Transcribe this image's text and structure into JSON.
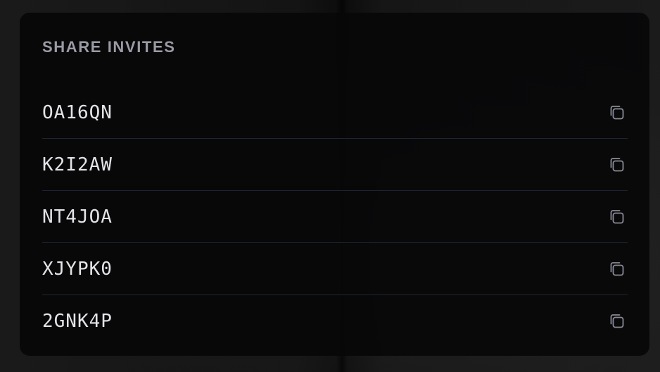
{
  "panel": {
    "title": "SHARE INVITES"
  },
  "invites": [
    {
      "code": "OA16QN",
      "action_icon": "copy-icon"
    },
    {
      "code": "K2I2AW",
      "action_icon": "copy-icon"
    },
    {
      "code": "NT4JOA",
      "action_icon": "copy-icon"
    },
    {
      "code": "XJYPK0",
      "action_icon": "copy-icon"
    },
    {
      "code": "2GNK4P",
      "action_icon": "copy-icon"
    }
  ],
  "colors": {
    "panel_background": "#080809",
    "title_text": "#9b9ba6",
    "code_text": "#e3e3e8",
    "divider": "#1e2530",
    "icon_stroke": "#8a8c96"
  }
}
